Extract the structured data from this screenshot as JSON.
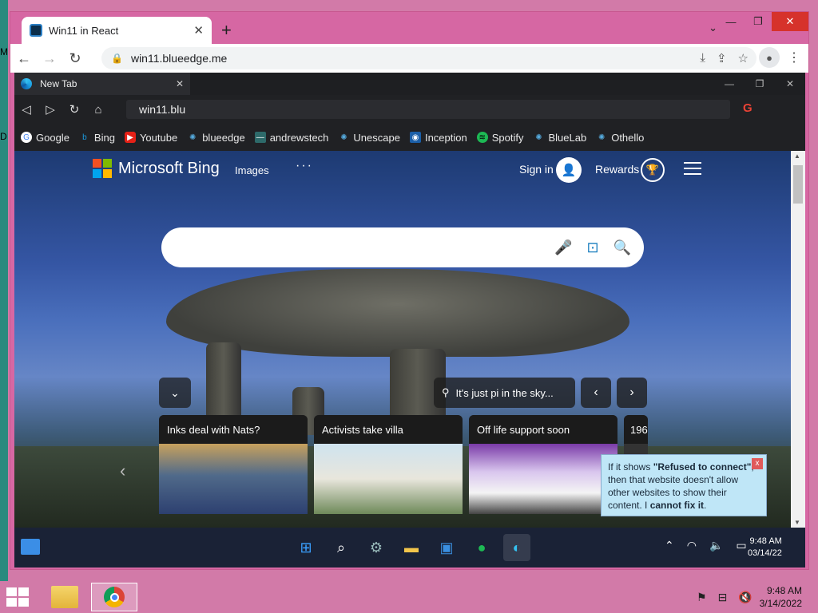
{
  "host": {
    "left_label_m": "M",
    "left_label_d": "D",
    "clock_time": "9:48 AM",
    "clock_date": "3/14/2022"
  },
  "chrome": {
    "tab_title": "Win11 in React",
    "url": "win11.blueedge.me"
  },
  "inner_browser": {
    "tab_title": "New Tab",
    "address_value": "win11.blu",
    "bookmarks": [
      "Google",
      "Bing",
      "Youtube",
      "blueedge",
      "andrewstech",
      "Unescape",
      "Inception",
      "Spotify",
      "BlueLab",
      "Othello"
    ]
  },
  "bing": {
    "brand": "Microsoft Bing",
    "nav_images": "Images",
    "nav_more": "···",
    "sign_in": "Sign in",
    "rewards": "Rewards",
    "caption": "It's just pi in the sky...",
    "cards": [
      {
        "title": "Inks deal with Nats?"
      },
      {
        "title": "Activists take villa"
      },
      {
        "title": "Off life support soon"
      },
      {
        "title": "196"
      }
    ]
  },
  "tooltip": {
    "part1": "If it shows ",
    "bold1": "\"Refused to connect\"",
    "part2": ", then that website doesn't allow other websites to show their content. I ",
    "bold2": "cannot fix it",
    "part3": "."
  },
  "w11_taskbar": {
    "time": "9:48 AM",
    "date": "03/14/22"
  },
  "colors": {
    "desktop": "#d27aa8",
    "bing_search_icon": "#1b7fbf",
    "tooltip_bg": "#bfe6f7"
  }
}
